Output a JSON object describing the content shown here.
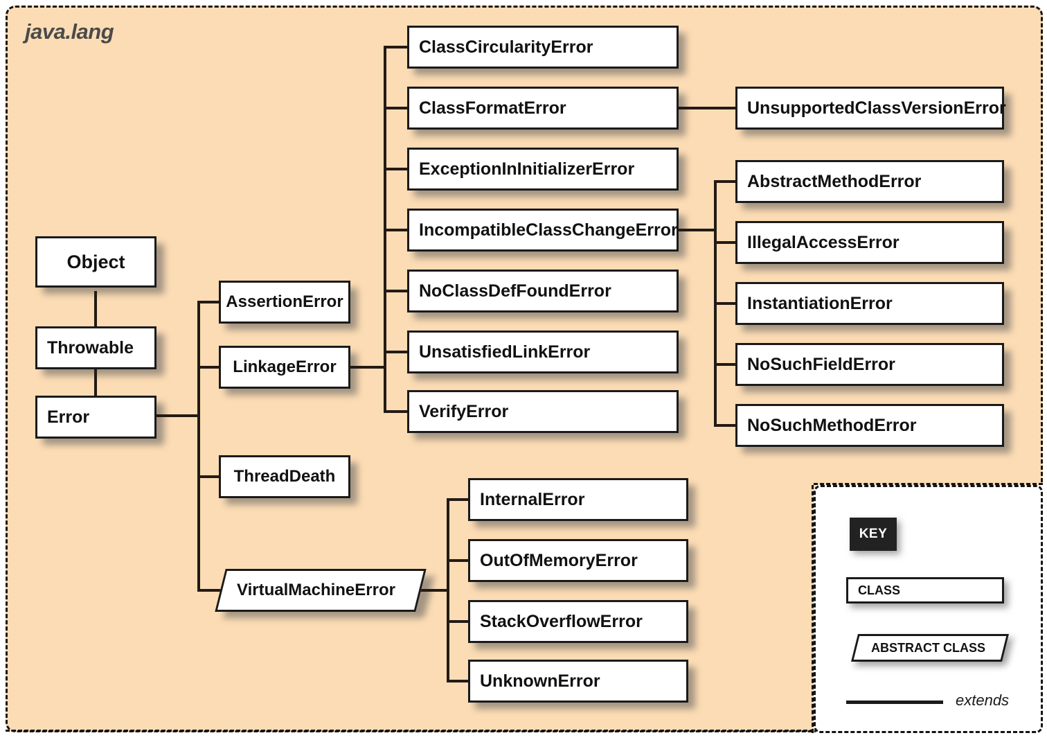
{
  "package": {
    "label": "java.lang"
  },
  "key": {
    "title": "KEY",
    "class_label": "CLASS",
    "abstract_label": "ABSTRACT CLASS",
    "extends_label": "extends"
  },
  "colors": {
    "package_background": "#fcdcb4",
    "node_background": "#ffffff",
    "stroke": "#1a1a1a",
    "package_label": "#4a4a4a",
    "key_tag_background": "#222222"
  },
  "nodes": {
    "object": {
      "label": "Object",
      "kind": "class"
    },
    "throwable": {
      "label": "Throwable",
      "kind": "class"
    },
    "error": {
      "label": "Error",
      "kind": "class"
    },
    "assertion_error": {
      "label": "AssertionError",
      "kind": "class"
    },
    "linkage_error": {
      "label": "LinkageError",
      "kind": "class"
    },
    "thread_death": {
      "label": "ThreadDeath",
      "kind": "class"
    },
    "virtual_machine_error": {
      "label": "VirtualMachineError",
      "kind": "abstract"
    },
    "class_circularity_error": {
      "label": "ClassCircularityError",
      "kind": "class"
    },
    "class_format_error": {
      "label": "ClassFormatError",
      "kind": "class"
    },
    "exception_in_initializer_error": {
      "label": "ExceptionInInitializerError",
      "kind": "class"
    },
    "incompatible_class_change_error": {
      "label": "IncompatibleClassChangeError",
      "kind": "class"
    },
    "no_class_def_found_error": {
      "label": "NoClassDefFoundError",
      "kind": "class"
    },
    "unsatisfied_link_error": {
      "label": "UnsatisfiedLinkError",
      "kind": "class"
    },
    "verify_error": {
      "label": "VerifyError",
      "kind": "class"
    },
    "unsupported_class_version_error": {
      "label": "UnsupportedClassVersionError",
      "kind": "class"
    },
    "abstract_method_error": {
      "label": "AbstractMethodError",
      "kind": "class"
    },
    "illegal_access_error": {
      "label": "IllegalAccessError",
      "kind": "class"
    },
    "instantiation_error": {
      "label": "InstantiationError",
      "kind": "class"
    },
    "no_such_field_error": {
      "label": "NoSuchFieldError",
      "kind": "class"
    },
    "no_such_method_error": {
      "label": "NoSuchMethodError",
      "kind": "class"
    },
    "internal_error": {
      "label": "InternalError",
      "kind": "class"
    },
    "out_of_memory_error": {
      "label": "OutOfMemoryError",
      "kind": "class"
    },
    "stack_overflow_error": {
      "label": "StackOverflowError",
      "kind": "class"
    },
    "unknown_error": {
      "label": "UnknownError",
      "kind": "class"
    }
  },
  "edges": [
    {
      "from": "Object",
      "to": "Throwable"
    },
    {
      "from": "Throwable",
      "to": "Error"
    },
    {
      "from": "Error",
      "to": "AssertionError"
    },
    {
      "from": "Error",
      "to": "LinkageError"
    },
    {
      "from": "Error",
      "to": "ThreadDeath"
    },
    {
      "from": "Error",
      "to": "VirtualMachineError"
    },
    {
      "from": "LinkageError",
      "to": "ClassCircularityError"
    },
    {
      "from": "LinkageError",
      "to": "ClassFormatError"
    },
    {
      "from": "LinkageError",
      "to": "ExceptionInInitializerError"
    },
    {
      "from": "LinkageError",
      "to": "IncompatibleClassChangeError"
    },
    {
      "from": "LinkageError",
      "to": "NoClassDefFoundError"
    },
    {
      "from": "LinkageError",
      "to": "UnsatisfiedLinkError"
    },
    {
      "from": "LinkageError",
      "to": "VerifyError"
    },
    {
      "from": "ClassFormatError",
      "to": "UnsupportedClassVersionError"
    },
    {
      "from": "IncompatibleClassChangeError",
      "to": "AbstractMethodError"
    },
    {
      "from": "IncompatibleClassChangeError",
      "to": "IllegalAccessError"
    },
    {
      "from": "IncompatibleClassChangeError",
      "to": "InstantiationError"
    },
    {
      "from": "IncompatibleClassChangeError",
      "to": "NoSuchFieldError"
    },
    {
      "from": "IncompatibleClassChangeError",
      "to": "NoSuchMethodError"
    },
    {
      "from": "VirtualMachineError",
      "to": "InternalError"
    },
    {
      "from": "VirtualMachineError",
      "to": "OutOfMemoryError"
    },
    {
      "from": "VirtualMachineError",
      "to": "StackOverflowError"
    },
    {
      "from": "VirtualMachineError",
      "to": "UnknownError"
    }
  ]
}
